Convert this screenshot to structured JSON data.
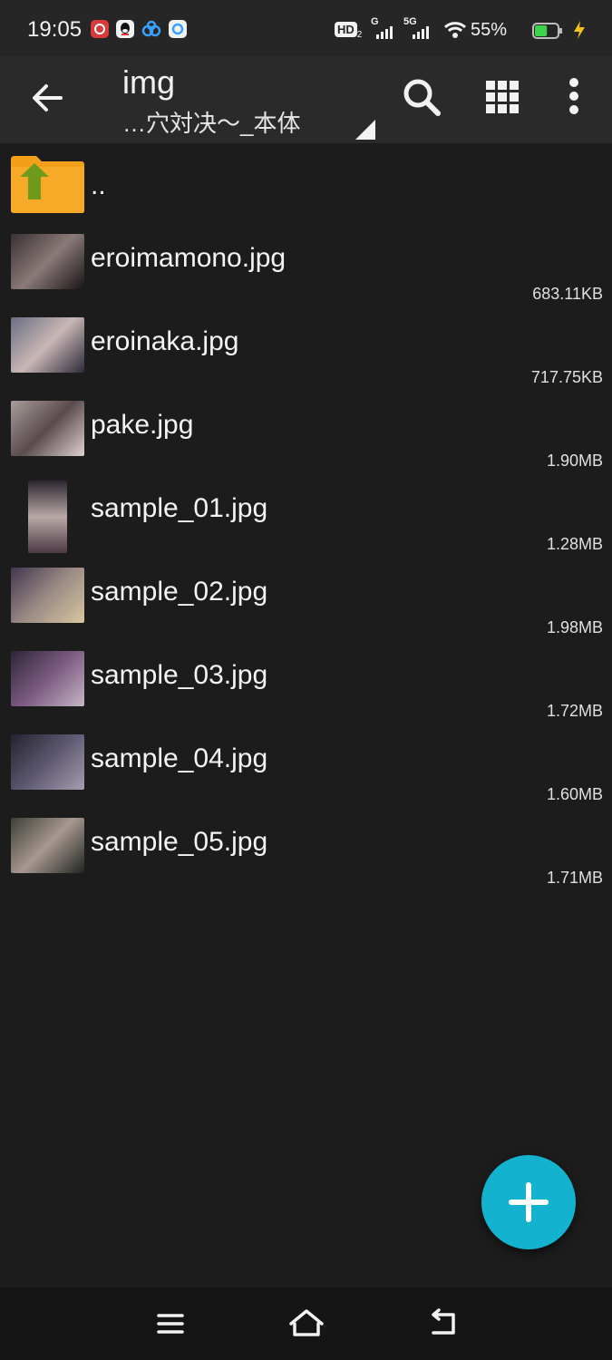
{
  "status_bar": {
    "time": "19:05",
    "battery_percent": "55%",
    "network_1": "G",
    "network_2": "5G",
    "hd_label": "HD",
    "hd_sub": "2",
    "battery_level": 0.55,
    "app_icons": [
      "netease-music-icon",
      "qq-icon",
      "baidu-netdisk-icon",
      "cloud-app-icon"
    ]
  },
  "toolbar": {
    "title": "img",
    "subtitle": "…穴対决～_本体"
  },
  "files": [
    {
      "name": "..",
      "size": "",
      "type": "parent-folder"
    },
    {
      "name": "eroimamono.jpg",
      "size": "683.11KB",
      "thumb_colors": [
        "#3a3032",
        "#8a7a78",
        "#1a1416"
      ]
    },
    {
      "name": "eroinaka.jpg",
      "size": "717.75KB",
      "thumb_colors": [
        "#6a6f86",
        "#c8b6b4",
        "#2c2a3a"
      ]
    },
    {
      "name": "pake.jpg",
      "size": "1.90MB",
      "thumb_colors": [
        "#a89d9a",
        "#5a4b4e",
        "#e0d2cf"
      ]
    },
    {
      "name": "sample_01.jpg",
      "size": "1.28MB",
      "thumb_colors": [
        "#2b2630",
        "#b8a8a6",
        "#4d3a45"
      ]
    },
    {
      "name": "sample_02.jpg",
      "size": "1.98MB",
      "thumb_colors": [
        "#42364e",
        "#9a8a84",
        "#d8c6a0"
      ]
    },
    {
      "name": "sample_03.jpg",
      "size": "1.72MB",
      "thumb_colors": [
        "#2c2538",
        "#7b5a80",
        "#c7b5c6"
      ]
    },
    {
      "name": "sample_04.jpg",
      "size": "1.60MB",
      "thumb_colors": [
        "#24222e",
        "#5d5870",
        "#a59db0"
      ]
    },
    {
      "name": "sample_05.jpg",
      "size": "1.71MB",
      "thumb_colors": [
        "#3c4038",
        "#a89890",
        "#1e2420"
      ]
    }
  ],
  "colors": {
    "accent": "#13b3cf",
    "folder": "#f2a01a",
    "arrow": "#6f9a1c",
    "battery": "#3cd24a"
  }
}
